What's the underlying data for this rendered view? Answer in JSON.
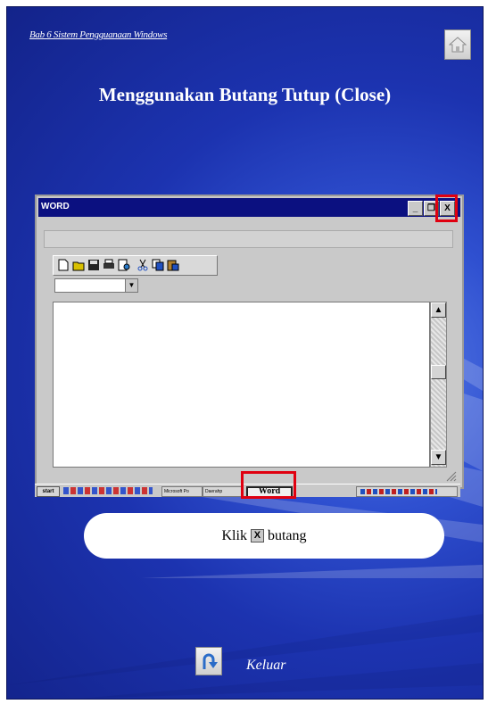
{
  "header": {
    "chapter": "Bab 6 Sistem Pengguanaan Windows",
    "home_icon": "home-icon"
  },
  "slide": {
    "title": "Menggunakan Butang Tutup (Close)"
  },
  "window": {
    "title": "WORD",
    "buttons": {
      "minimize": "_",
      "restore": "❐",
      "close": "X"
    },
    "scroll": {
      "up": "▲",
      "down": "▼"
    },
    "combo_arrow": "▼"
  },
  "taskbar": {
    "start": "start",
    "tasks": [
      "Microsoft Po",
      "Daerahp",
      "Word"
    ]
  },
  "callout": {
    "prefix": "Klik",
    "button": "X",
    "suffix": "butang"
  },
  "footer": {
    "exit_label": "Keluar",
    "exit_icon": "u-turn-arrow-icon"
  },
  "colors": {
    "background": "#1c33b0",
    "title_bar": "#0b1080",
    "highlight": "#e00010"
  }
}
